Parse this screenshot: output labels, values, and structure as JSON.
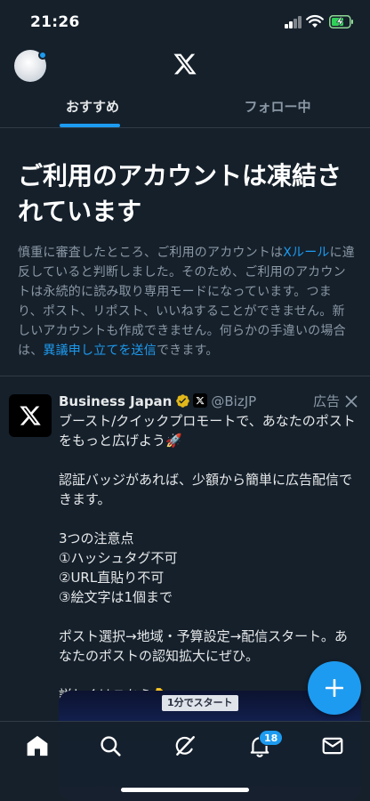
{
  "status_bar": {
    "time": "21:26"
  },
  "tabs": {
    "recommended": "おすすめ",
    "following": "フォロー中"
  },
  "notice": {
    "title": "ご利用のアカウントは凍結されています",
    "body_part1": "慎重に審査したところ、ご利用のアカウントは",
    "rules_link": "Xルール",
    "body_part2": "に違反していると判断しました。そのため、ご利用のアカウントは永続的に読み取り専用モードになっています。つまり、ポスト、リポスト、いいねすることができません。新しいアカウントも作成できません。何らかの手違いの場合は、",
    "appeal_link": "異議申し立てを送信",
    "body_part3": "できます。"
  },
  "ad_post": {
    "name": "Business Japan",
    "handle": "@BizJP",
    "ad_label": "広告",
    "text": "ブースト/クイックプロモートで、あなたのポストをもっと広げよう🚀\n\n認証バッジがあれば、少額から簡単に広告配信できます。\n\n3つの注意点\n①ハッシュタグ不可\n②URL直貼り不可\n③絵文字は1個まで\n\nポスト選択→地域・予算設定→配信スタート。あなたのポストの認知拡大にぜひ。\n\n詳しくはこちら👇",
    "media_label": "1分でスタート"
  },
  "bottom_nav": {
    "notifications_badge": "18"
  },
  "colors": {
    "background": "#15202b",
    "accent": "#1d9bf0",
    "muted_text": "#8b98a5",
    "verified_gold": "#e2b719"
  },
  "icons": [
    "avatar",
    "x-logo",
    "verified-badge-icon",
    "x-affiliate-icon",
    "close-icon",
    "compose-plus-icon",
    "home-icon",
    "search-icon",
    "grok-icon",
    "bell-icon",
    "mail-icon"
  ]
}
